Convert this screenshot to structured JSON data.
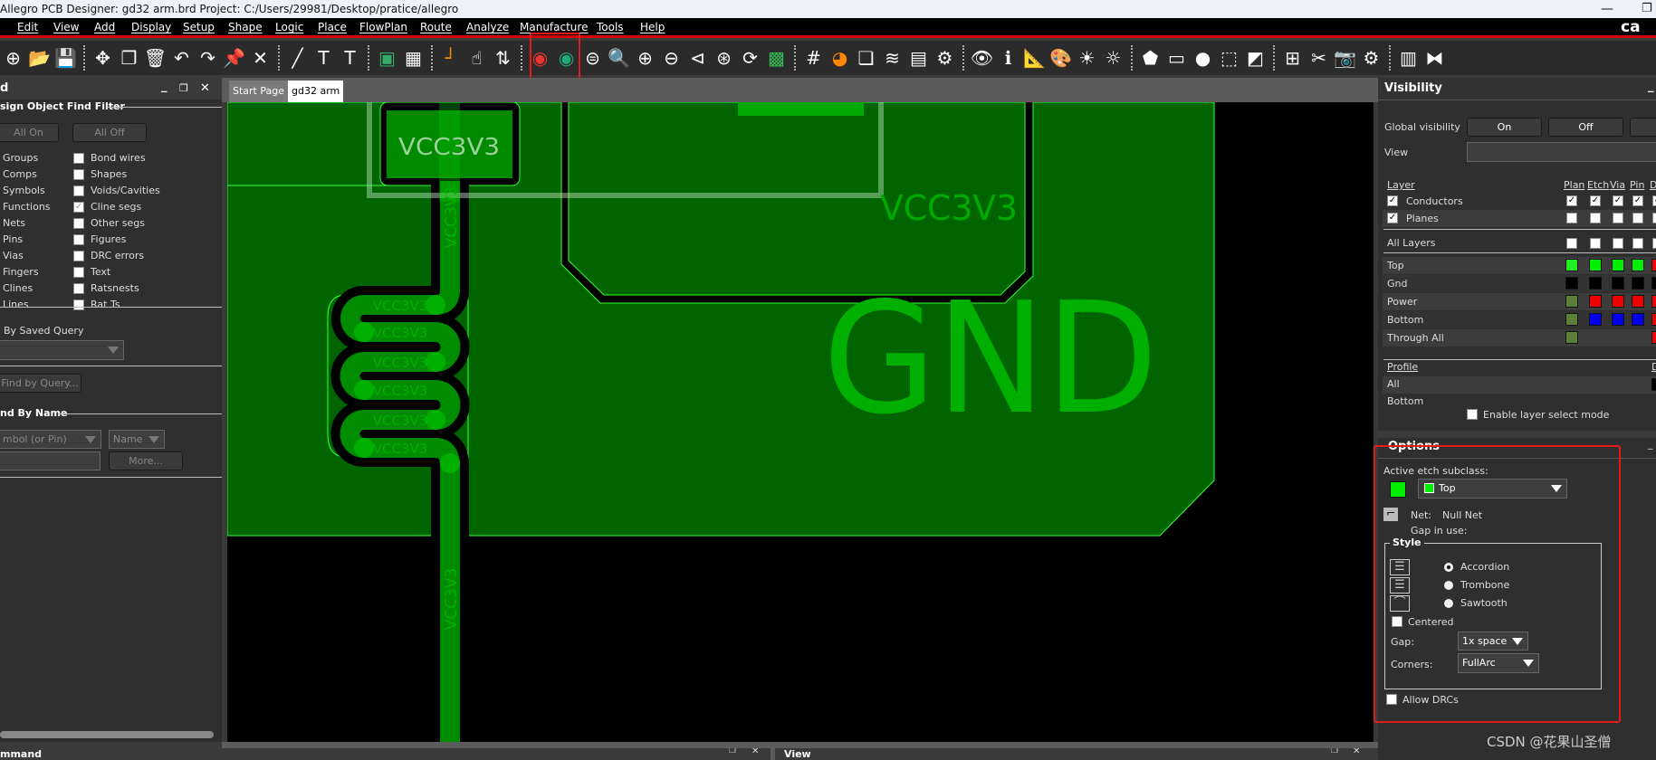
{
  "window": {
    "title": "Allegro PCB Designer: gd32 arm.brd  Project: C:/Users/29981/Desktop/pratice/allegro",
    "logo": "ca",
    "minimize_icon": "minimize-icon",
    "restore_icon": "restore-icon"
  },
  "menu": [
    "Edit",
    "View",
    "Add",
    "Display",
    "Setup",
    "Shape",
    "Logic",
    "Place",
    "FlowPlan",
    "Route",
    "Analyze",
    "Manufacture",
    "Tools",
    "Help"
  ],
  "toolbar": {
    "groups": [
      [
        {
          "name": "new-icon",
          "glyph": "⊕"
        },
        {
          "name": "open-icon",
          "glyph": "📂"
        },
        {
          "name": "save-icon",
          "glyph": "💾"
        }
      ],
      [
        {
          "name": "move-icon",
          "glyph": "✥"
        },
        {
          "name": "copy-icon",
          "glyph": "❐"
        },
        {
          "name": "delete-icon",
          "glyph": "🗑"
        },
        {
          "name": "undo-icon",
          "glyph": "↶"
        },
        {
          "name": "redo-icon",
          "glyph": "↷"
        },
        {
          "name": "fix-icon",
          "glyph": "📌"
        },
        {
          "name": "unfix-icon",
          "glyph": "✕"
        }
      ],
      [
        {
          "name": "add-line-icon",
          "glyph": "╱"
        },
        {
          "name": "add-text-icon",
          "glyph": "T"
        },
        {
          "name": "edit-text-icon",
          "glyph": "T"
        }
      ],
      [
        {
          "name": "place-component-icon",
          "glyph": "▣"
        },
        {
          "name": "chip-icon",
          "glyph": "▦"
        }
      ],
      [
        {
          "name": "add-connect-icon",
          "glyph": "┘"
        },
        {
          "name": "slide-icon",
          "glyph": "☝"
        },
        {
          "name": "delay-tune-icon",
          "glyph": "⇅"
        }
      ],
      [
        {
          "name": "drc-red-icon",
          "glyph": "◉"
        },
        {
          "name": "drc-green-icon",
          "glyph": "◉"
        },
        {
          "name": "zoom-fit-icon",
          "glyph": "⊜"
        },
        {
          "name": "zoom-window-icon",
          "glyph": "🔍"
        },
        {
          "name": "zoom-in-icon",
          "glyph": "⊕"
        },
        {
          "name": "zoom-out-icon",
          "glyph": "⊖"
        },
        {
          "name": "zoom-previous-icon",
          "glyph": "⊲"
        },
        {
          "name": "zoom-center-icon",
          "glyph": "⊛"
        },
        {
          "name": "redraw-icon",
          "glyph": "⟳"
        },
        {
          "name": "board-icon",
          "glyph": "▩"
        }
      ],
      [
        {
          "name": "grid-icon",
          "glyph": "#"
        },
        {
          "name": "color-icon",
          "glyph": "◕"
        },
        {
          "name": "shadow-icon",
          "glyph": "❏"
        },
        {
          "name": "layers-icon",
          "glyph": "≋"
        },
        {
          "name": "report-icon",
          "glyph": "▤"
        },
        {
          "name": "settings-doc-icon",
          "glyph": "⚙"
        }
      ],
      [
        {
          "name": "visibility-icon",
          "glyph": "👁"
        },
        {
          "name": "info-icon",
          "glyph": "ℹ"
        },
        {
          "name": "measure-icon",
          "glyph": "📐"
        },
        {
          "name": "palette-icon",
          "glyph": "🎨"
        },
        {
          "name": "highlight-icon",
          "glyph": "☀"
        },
        {
          "name": "dehighlight-icon",
          "glyph": "☼"
        }
      ],
      [
        {
          "name": "add-shape-icon",
          "glyph": "⬟"
        },
        {
          "name": "add-rect-icon",
          "glyph": "▭"
        },
        {
          "name": "add-circle-icon",
          "glyph": "●"
        },
        {
          "name": "select-shape-icon",
          "glyph": "⬚"
        },
        {
          "name": "shape-edit-icon",
          "glyph": "◩"
        }
      ],
      [
        {
          "name": "constraint-icon",
          "glyph": "⊞"
        },
        {
          "name": "tools-icon",
          "glyph": "✂"
        },
        {
          "name": "camera-icon",
          "glyph": "📷"
        },
        {
          "name": "gear-icon",
          "glyph": "⚙"
        }
      ],
      [
        {
          "name": "report-chart-icon",
          "glyph": "▥"
        },
        {
          "name": "swap-icon",
          "glyph": "⧓"
        }
      ]
    ]
  },
  "tabs": [
    {
      "label": "Start Page",
      "active": false
    },
    {
      "label": "gd32 arm",
      "active": true
    }
  ],
  "find": {
    "title": "d",
    "subtitle": "sign Object Find Filter",
    "all_on": "All On",
    "all_off": "All Off",
    "left_items": [
      "Groups",
      "Comps",
      "Symbols",
      "Functions",
      "Nets",
      "Pins",
      "Vias",
      "Fingers",
      "Clines",
      "Lines"
    ],
    "right_items": [
      {
        "label": "Bond wires",
        "checked": false
      },
      {
        "label": "Shapes",
        "checked": false
      },
      {
        "label": "Voids/Cavities",
        "checked": false
      },
      {
        "label": "Cline segs",
        "checked": true
      },
      {
        "label": "Other segs",
        "checked": false
      },
      {
        "label": "Figures",
        "checked": false
      },
      {
        "label": "DRC errors",
        "checked": false
      },
      {
        "label": "Text",
        "checked": false
      },
      {
        "label": "Ratsnests",
        "checked": false
      },
      {
        "label": "Rat Ts",
        "checked": false
      }
    ],
    "saved_query_label": "By Saved Query",
    "saved_query_value": "",
    "find_by_query": "Find by Query...",
    "by_name_title": "nd By Name",
    "object_type": "mbol (or Pin)",
    "name_type": "Name",
    "name_value": "",
    "more": "More..."
  },
  "canvas": {
    "pad_label": "VCC3V3",
    "shape_label": "VCC3V3",
    "plane_label": "GND",
    "trace_label": "VCC3V3",
    "loop_label": "VCC3V3",
    "colors": {
      "plane": "#006400",
      "trace": "#008c00",
      "text": "#00b000",
      "outline": "#33ff33"
    }
  },
  "visibility": {
    "title": "Visibility",
    "global_label": "Global visibility",
    "on": "On",
    "off": "Off",
    "view_label": "View",
    "view_value": "",
    "layer_header": "Layer",
    "columns": [
      "Plan",
      "Etch",
      "Via",
      "Pin",
      "D"
    ],
    "groups": [
      {
        "label": "Conductors",
        "checked": true,
        "cols": [
          true,
          true,
          true,
          true,
          true
        ]
      },
      {
        "label": "Planes",
        "checked": true,
        "cols": [
          false,
          false,
          false,
          false,
          false
        ]
      }
    ],
    "all_layers": "All Layers",
    "layers": [
      {
        "label": "Top",
        "colors": [
          "#22ee22",
          "#00ee00",
          "#00ee00",
          "#00ee00",
          "#ee0000"
        ]
      },
      {
        "label": "Gnd",
        "colors": [
          "#000000",
          "#000000",
          "#000000",
          "#000000",
          "#000000"
        ]
      },
      {
        "label": "Power",
        "colors": [
          "#5a7f35",
          "#ee0000",
          "#ee0000",
          "#ee0000",
          "#ee0000"
        ]
      },
      {
        "label": "Bottom",
        "colors": [
          "#5a7f35",
          "#0000ee",
          "#0000ee",
          "#0000ee",
          "#ee0000"
        ]
      },
      {
        "label": "Through All",
        "colors": [
          "#5a7f35",
          null,
          null,
          null,
          "#ee0000"
        ]
      }
    ],
    "profile_header": "Profile",
    "profile_col": "D",
    "profiles": [
      "All",
      "Bottom"
    ],
    "enable_layer_select": "Enable layer select mode"
  },
  "options": {
    "title": "Options",
    "active_etch_label": "Active etch subclass:",
    "active_color": "#00ee00",
    "subclass": "Top",
    "net_label": "Net:",
    "net_value": "Null Net",
    "gap_in_use": "Gap in use:",
    "style_title": "Style",
    "styles": [
      {
        "label": "Accordion",
        "selected": true
      },
      {
        "label": "Trombone",
        "selected": false
      },
      {
        "label": "Sawtooth",
        "selected": false
      }
    ],
    "centered": "Centered",
    "gap_label": "Gap:",
    "gap_value": "1x space",
    "corners_label": "Corners:",
    "corners_value": "FullArc",
    "allow_drcs": "Allow DRCs"
  },
  "bottom": {
    "command_title": "mmand",
    "view_title": "View"
  },
  "watermark": "CSDN @花果山圣僧"
}
